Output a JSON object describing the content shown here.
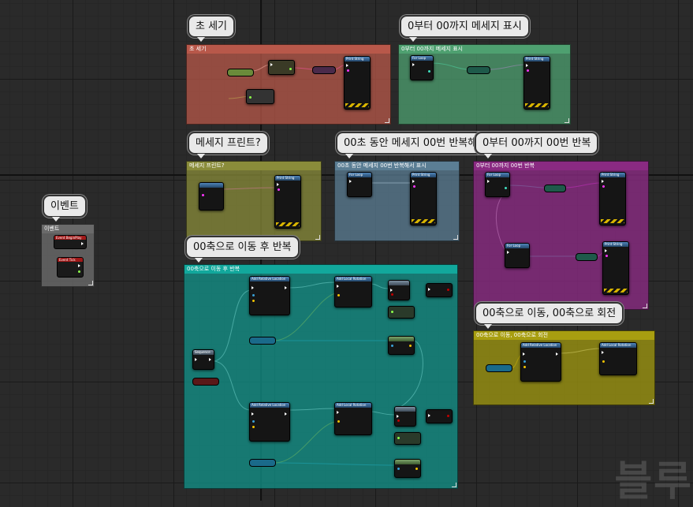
{
  "comments": {
    "seconds": {
      "bubble": "초 세기",
      "header": "초 세기",
      "color": "#b8584a"
    },
    "count": {
      "bubble": "0부터 00까지  메세지 표시",
      "header": "0부터 00까지  메세지 표시",
      "color": "#4ea070"
    },
    "print": {
      "bubble": "메세지 프린트?",
      "header": "메세지 프린트?",
      "color": "#8a8c3a"
    },
    "repeat_msg": {
      "bubble": "00초 동안 메세지 00번 반복해서 표시",
      "header": "00초 동안 메세지 00번 반복해서 표시",
      "color": "#5b7e94"
    },
    "repeat_count": {
      "bubble": "0부터 00까지 00번 반복",
      "header": "0부터 00까지 00번 반복",
      "color": "#8a2a82"
    },
    "events": {
      "bubble": "이벤트",
      "header": "이벤트",
      "color": "#6a6a6a"
    },
    "move_repeat": {
      "bubble": "00축으로 이동 후 반복",
      "header": "00축으로 이동 후 반복",
      "color": "#128f86"
    },
    "move_rotate": {
      "bubble": "00축으로 이동, 00축으로 회전",
      "header": "00축으로 이동, 00축으로 회전",
      "color": "#9a9210"
    }
  },
  "nodes": {
    "print_string": "Print String",
    "for_loop": "For Loop",
    "add_relative_location": "Add Relative Location",
    "add_local_rotation": "Add Local Rotation",
    "event_begin_play": "Event BeginPlay",
    "event_tick": "Event Tick",
    "sequence": "Sequence",
    "delay": "Delay"
  },
  "pin_colors": {
    "exec": "#ffffff",
    "int": "#3fe0c0",
    "string": "#ff36ff",
    "vector": "#f5c400",
    "float": "#8cff4a",
    "bool": "#c00000"
  },
  "watermark": "블루"
}
